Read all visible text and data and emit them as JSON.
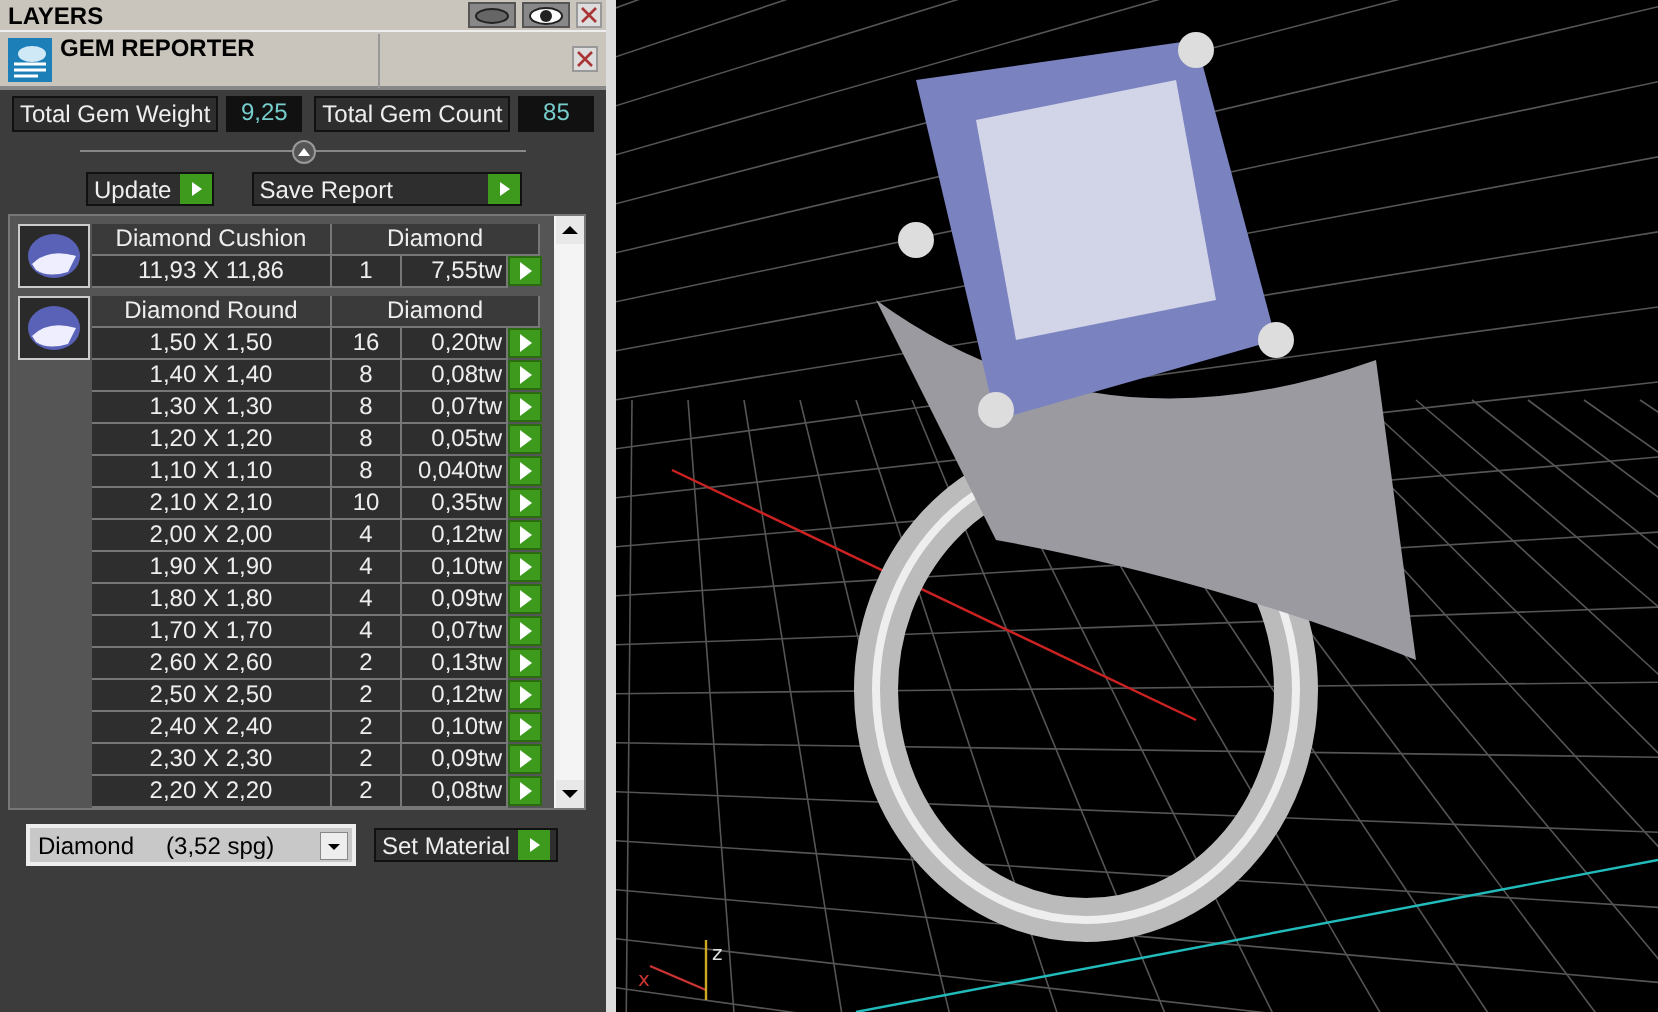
{
  "layers_bar": {
    "title": "LAYERS"
  },
  "panel": {
    "title": "GEM REPORTER"
  },
  "totals": [
    {
      "label": "Total Gem Weight",
      "value": "9,25"
    },
    {
      "label": "Total Gem Count",
      "value": "85"
    }
  ],
  "actions": [
    "Update",
    "Save Report"
  ],
  "groups": [
    {
      "name": "Diamond Cushion",
      "material": "Diamond",
      "rows": [
        {
          "size": "11,93 X 11,86",
          "count": "1",
          "weight": "7,55tw"
        }
      ]
    },
    {
      "name": "Diamond Round",
      "material": "Diamond",
      "rows": [
        {
          "size": "1,50 X 1,50",
          "count": "16",
          "weight": "0,20tw"
        },
        {
          "size": "1,40 X 1,40",
          "count": "8",
          "weight": "0,08tw"
        },
        {
          "size": "1,30 X 1,30",
          "count": "8",
          "weight": "0,07tw"
        },
        {
          "size": "1,20 X 1,20",
          "count": "8",
          "weight": "0,05tw"
        },
        {
          "size": "1,10 X 1,10",
          "count": "8",
          "weight": "0,040tw"
        },
        {
          "size": "2,10 X 2,10",
          "count": "10",
          "weight": "0,35tw"
        },
        {
          "size": "2,00 X 2,00",
          "count": "4",
          "weight": "0,12tw"
        },
        {
          "size": "1,90 X 1,90",
          "count": "4",
          "weight": "0,10tw"
        },
        {
          "size": "1,80 X 1,80",
          "count": "4",
          "weight": "0,09tw"
        },
        {
          "size": "1,70 X 1,70",
          "count": "4",
          "weight": "0,07tw"
        },
        {
          "size": "2,60 X 2,60",
          "count": "2",
          "weight": "0,13tw"
        },
        {
          "size": "2,50 X 2,50",
          "count": "2",
          "weight": "0,12tw"
        },
        {
          "size": "2,40 X 2,40",
          "count": "2",
          "weight": "0,10tw"
        },
        {
          "size": "2,30 X 2,30",
          "count": "2",
          "weight": "0,09tw"
        },
        {
          "size": "2,20 X 2,20",
          "count": "2",
          "weight": "0,08tw"
        }
      ]
    }
  ],
  "material": {
    "name": "Diamond",
    "density": "(3,52 spg)",
    "button": "Set Material"
  },
  "viewport": {
    "axis_labels": [
      "x",
      "z"
    ]
  }
}
